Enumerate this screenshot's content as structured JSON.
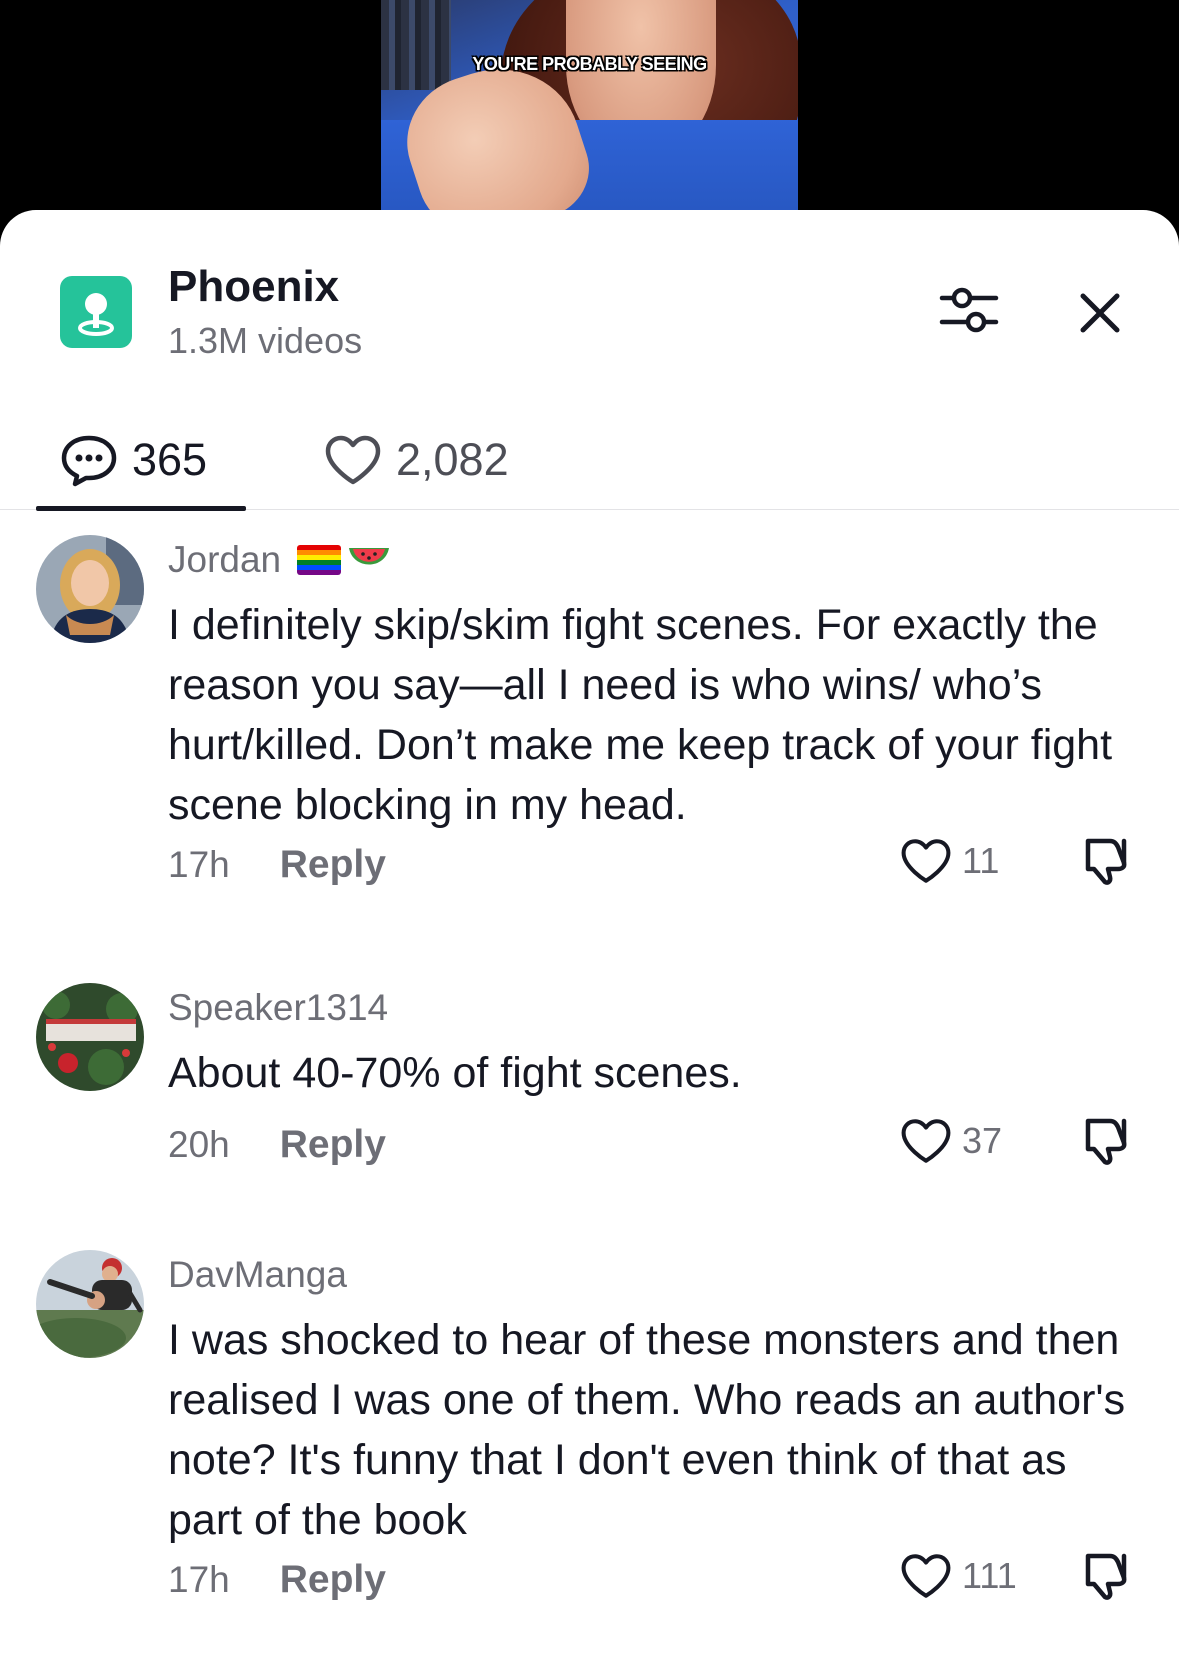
{
  "video": {
    "caption": "YOU'RE PROBABLY SEEING"
  },
  "header": {
    "topic_name": "Phoenix",
    "topic_count": "1.3M videos"
  },
  "tabs": {
    "comments_count": "365",
    "likes_count": "2,082"
  },
  "comments": [
    {
      "username": "Jordan",
      "badges": [
        "rainbow-flag-emoji",
        "watermelon-emoji"
      ],
      "text": "I definitely skip/skim fight scenes. For exactly the reason you say—all I need is who wins/ who’s hurt/killed. Don’t make me keep track of your fight scene blocking in my head.",
      "time": "17h",
      "reply_label": "Reply",
      "likes": "11"
    },
    {
      "username": "Speaker1314",
      "text": "About 40-70% of fight scenes.",
      "time": "20h",
      "reply_label": "Reply",
      "likes": "37"
    },
    {
      "username": "DavManga",
      "text": "I was shocked to hear of these monsters and then realised I was one of them. Who reads an author's note? It's funny that I don't even think of that as part of the book",
      "time": "17h",
      "reply_label": "Reply",
      "likes": "111"
    }
  ],
  "colors": {
    "topic_icon_bg": "#25c39a",
    "primary_text": "#161823",
    "secondary_text": "#6d6e76"
  }
}
